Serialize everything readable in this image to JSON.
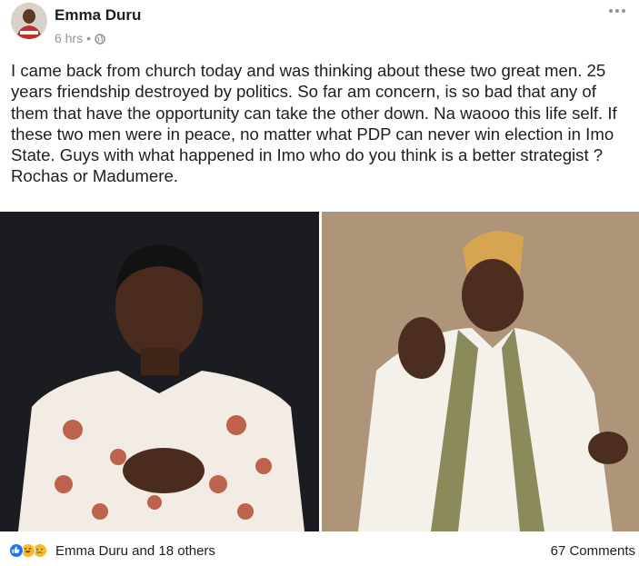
{
  "post": {
    "author": "Emma Duru",
    "time": "6 hrs",
    "separator": "•",
    "privacy_icon": "public-globe-icon",
    "more_icon": "ellipsis-icon",
    "text": "I came back from church today and was thinking about these two great men. 25 years friendship destroyed by politics. So far am concern, is so bad that any of them that have the opportunity can take the other down. Na waooo this life self. If these two men were in peace, no matter what PDP can never win election in Imo State. Guys with what happened in Imo who do you think is a better strategist ? Rochas or Madumere.",
    "photos": [
      {
        "name": "photo-left",
        "description_icon": "photo-icon"
      },
      {
        "name": "photo-right",
        "description_icon": "photo-icon"
      }
    ]
  },
  "footer": {
    "reaction_icons": [
      "like-icon",
      "haha-icon",
      "sad-icon"
    ],
    "reactors_text": "Emma Duru and 18 others",
    "comments_text": "67 Comments"
  },
  "colors": {
    "like": "#1877f2",
    "emoji": "#f7b928",
    "meta_text": "#8d949e",
    "text": "#1c1e21"
  }
}
